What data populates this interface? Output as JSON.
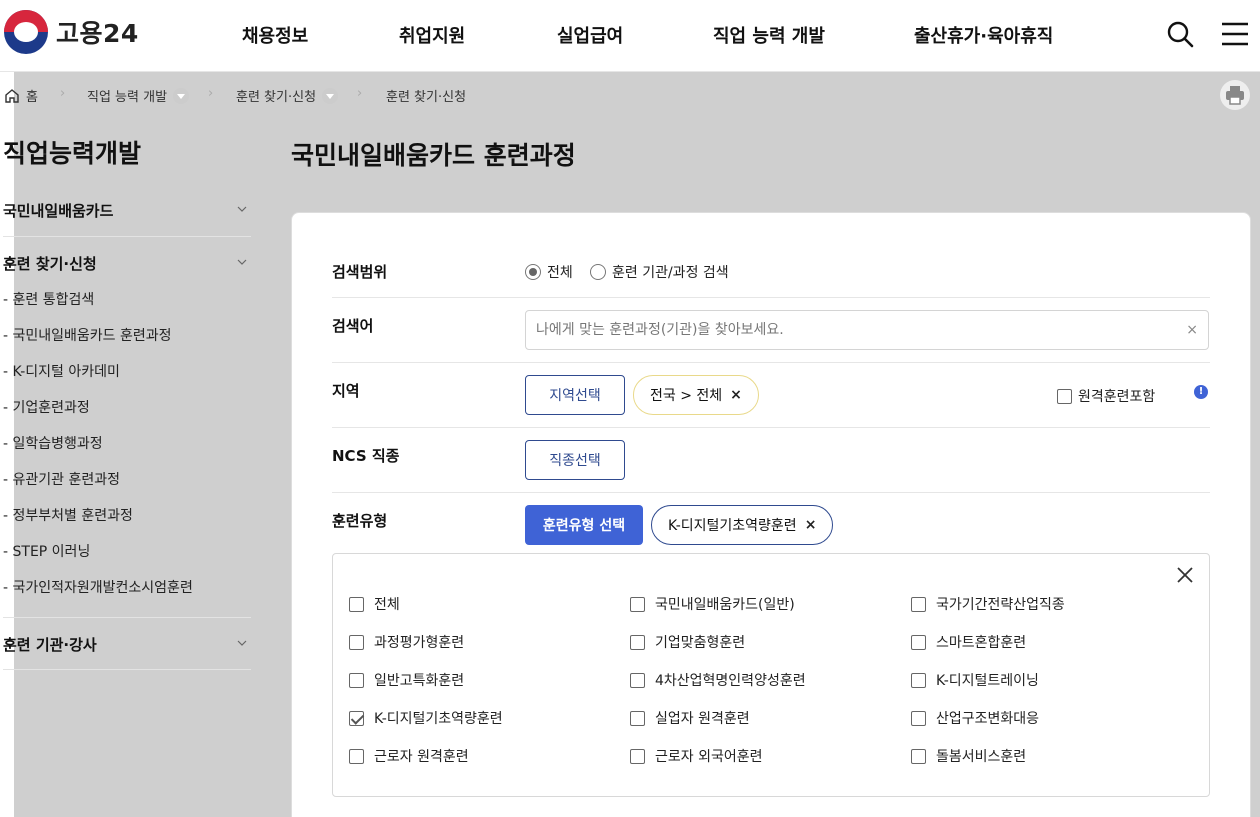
{
  "header": {
    "logo_text": "고용24",
    "nav": [
      "채용정보",
      "취업지원",
      "실업급여",
      "직업 능력 개발",
      "출산휴가·육아휴직"
    ]
  },
  "breadcrumb": [
    "홈",
    "직업 능력 개발",
    "훈련 찾기·신청",
    "훈련 찾기·신청"
  ],
  "sidebar": {
    "title": "직업능력개발",
    "groups": [
      {
        "label": "국민내일배움카드"
      },
      {
        "label": "훈련 찾기·신청",
        "items": [
          "- 훈련 통합검색",
          "- 국민내일배움카드 훈련과정",
          "- K-디지털 아카데미",
          "- 기업훈련과정",
          "- 일학습병행과정",
          "- 유관기관 훈련과정",
          "- 정부부처별 훈련과정",
          "- STEP 이러닝",
          "- 국가인적자원개발컨소시엄훈련"
        ]
      },
      {
        "label": "훈련 기관·강사"
      }
    ]
  },
  "main": {
    "title": "국민내일배움카드 훈련과정",
    "scope": {
      "label": "검색범위",
      "options": [
        "전체",
        "훈련 기관/과정 검색"
      ],
      "selected": "전체"
    },
    "keyword": {
      "label": "검색어",
      "placeholder": "나에게 맞는 훈련과정(기관)을 찾아보세요.",
      "clear": "×"
    },
    "region": {
      "label": "지역",
      "button": "지역선택",
      "chip": "전국 > 전체",
      "remote_label": "원격훈련포함",
      "info": "!"
    },
    "ncs": {
      "label": "NCS 직종",
      "button": "직종선택"
    },
    "training_type": {
      "label": "훈련유형",
      "button": "훈련유형 선택",
      "chip": "K-디지털기초역량훈련",
      "options": [
        {
          "label": "전체",
          "checked": false
        },
        {
          "label": "국민내일배움카드(일반)",
          "checked": false
        },
        {
          "label": "국가기간전략산업직종",
          "checked": false
        },
        {
          "label": "과정평가형훈련",
          "checked": false
        },
        {
          "label": "기업맞춤형훈련",
          "checked": false
        },
        {
          "label": "스마트혼합훈련",
          "checked": false
        },
        {
          "label": "일반고특화훈련",
          "checked": false
        },
        {
          "label": "4차산업혁명인력양성훈련",
          "checked": false
        },
        {
          "label": "K-디지털트레이닝",
          "checked": false
        },
        {
          "label": "K-디지털기초역량훈련",
          "checked": true
        },
        {
          "label": "실업자 원격훈련",
          "checked": false
        },
        {
          "label": "산업구조변화대응",
          "checked": false
        },
        {
          "label": "근로자 원격훈련",
          "checked": false
        },
        {
          "label": "근로자 외국어훈련",
          "checked": false
        },
        {
          "label": "돌봄서비스훈련",
          "checked": false
        }
      ]
    },
    "chip_remove": "×"
  },
  "colors": {
    "accent": "#3f63d6",
    "outline": "#2f4a8f",
    "chip_yellow_border": "#e9d98a"
  }
}
